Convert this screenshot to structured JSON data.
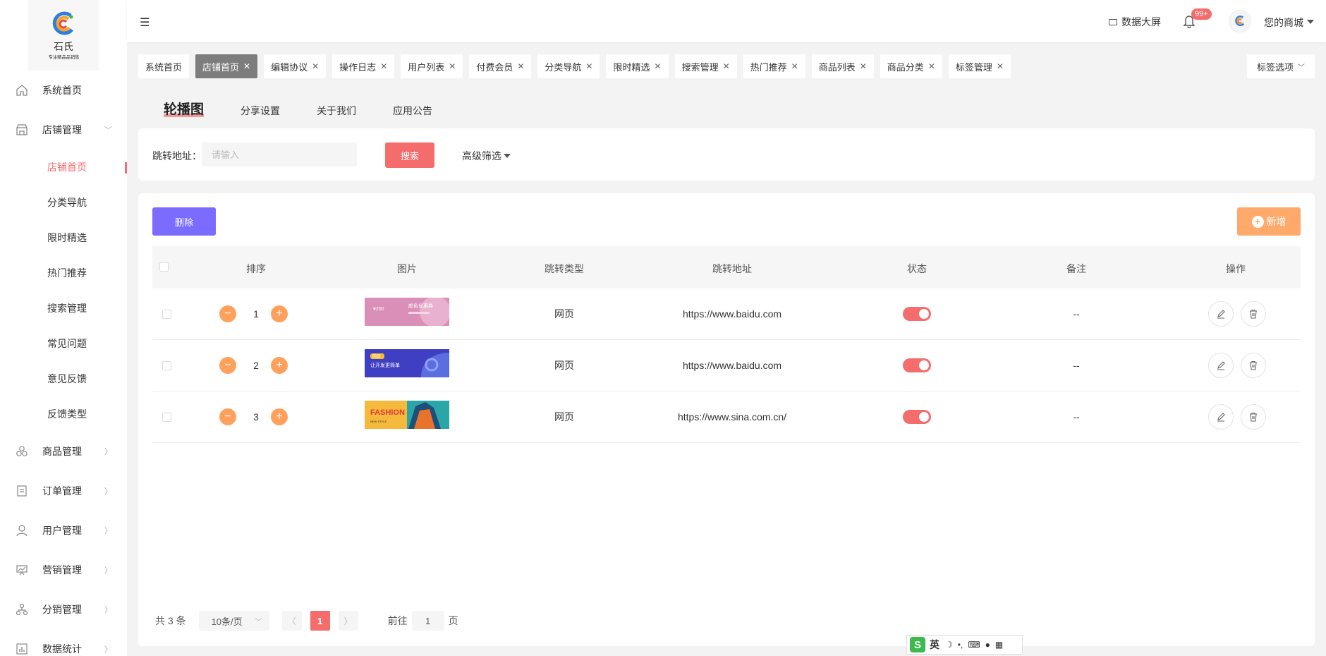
{
  "sidebar": {
    "logo": {
      "name": "石氏",
      "sub": "专注精品品销售"
    },
    "items": [
      {
        "label": "系统首页",
        "icon": "home-icon"
      },
      {
        "label": "店铺管理",
        "icon": "store-icon",
        "expanded": true
      },
      {
        "label": "商品管理",
        "icon": "goods-icon"
      },
      {
        "label": "订单管理",
        "icon": "order-icon"
      },
      {
        "label": "用户管理",
        "icon": "user-icon"
      },
      {
        "label": "营销管理",
        "icon": "marketing-icon"
      },
      {
        "label": "分销管理",
        "icon": "distribution-icon"
      },
      {
        "label": "数据统计",
        "icon": "stats-icon"
      }
    ],
    "sub_items": [
      "店铺首页",
      "分类导航",
      "限时精选",
      "热门推荐",
      "搜索管理",
      "常见问题",
      "意见反馈",
      "反馈类型"
    ],
    "active_sub": "店铺首页"
  },
  "header": {
    "data_screen": "数据大屏",
    "badge": "99+",
    "shop_name": "您的商城"
  },
  "tags": [
    {
      "label": "系统首页",
      "closable": false
    },
    {
      "label": "店铺首页",
      "closable": true,
      "active": true
    },
    {
      "label": "编辑协议",
      "closable": true
    },
    {
      "label": "操作日志",
      "closable": true
    },
    {
      "label": "用户列表",
      "closable": true
    },
    {
      "label": "付费会员",
      "closable": true
    },
    {
      "label": "分类导航",
      "closable": true
    },
    {
      "label": "限时精选",
      "closable": true
    },
    {
      "label": "搜索管理",
      "closable": true
    },
    {
      "label": "热门推荐",
      "closable": true
    },
    {
      "label": "商品列表",
      "closable": true
    },
    {
      "label": "商品分类",
      "closable": true
    },
    {
      "label": "标签管理",
      "closable": true
    }
  ],
  "tag_options": "标签选项",
  "subtabs": [
    "轮播图",
    "分享设置",
    "关于我们",
    "应用公告"
  ],
  "search": {
    "label": "跳转地址：",
    "placeholder": "请输入",
    "button": "搜索",
    "advanced": "高级筛选"
  },
  "actions": {
    "delete": "删除",
    "add": "新增"
  },
  "table": {
    "headers": [
      "排序",
      "图片",
      "跳转类型",
      "跳转地址",
      "状态",
      "备注",
      "操作"
    ],
    "rows": [
      {
        "order": "1",
        "type": "网页",
        "url": "https://www.baidu.com",
        "status": true,
        "note": "--",
        "banner": "pink"
      },
      {
        "order": "2",
        "type": "网页",
        "url": "https://www.baidu.com",
        "status": true,
        "note": "--",
        "banner": "blue"
      },
      {
        "order": "3",
        "type": "网页",
        "url": "https://www.sina.com.cn/",
        "status": true,
        "note": "--",
        "banner": "fashion"
      }
    ]
  },
  "banner_text": {
    "pink_price": "¥200",
    "pink_title": "颜色优惠券",
    "blue_tag": "网页",
    "blue_title": "让开发更简单",
    "fashion_title": "FASHION",
    "fashion_sub": "NEW STYLE"
  },
  "pagination": {
    "total": "共 3 条",
    "page_size": "10条/页",
    "current": "1",
    "goto_prefix": "前往",
    "goto_value": "1",
    "goto_suffix": "页"
  },
  "ime": {
    "lang": "英"
  },
  "colors": {
    "primary": "#f56c6c",
    "purple": "#7b6cff",
    "orange": "#ffaa6b",
    "stepper": "#ffa15c"
  }
}
